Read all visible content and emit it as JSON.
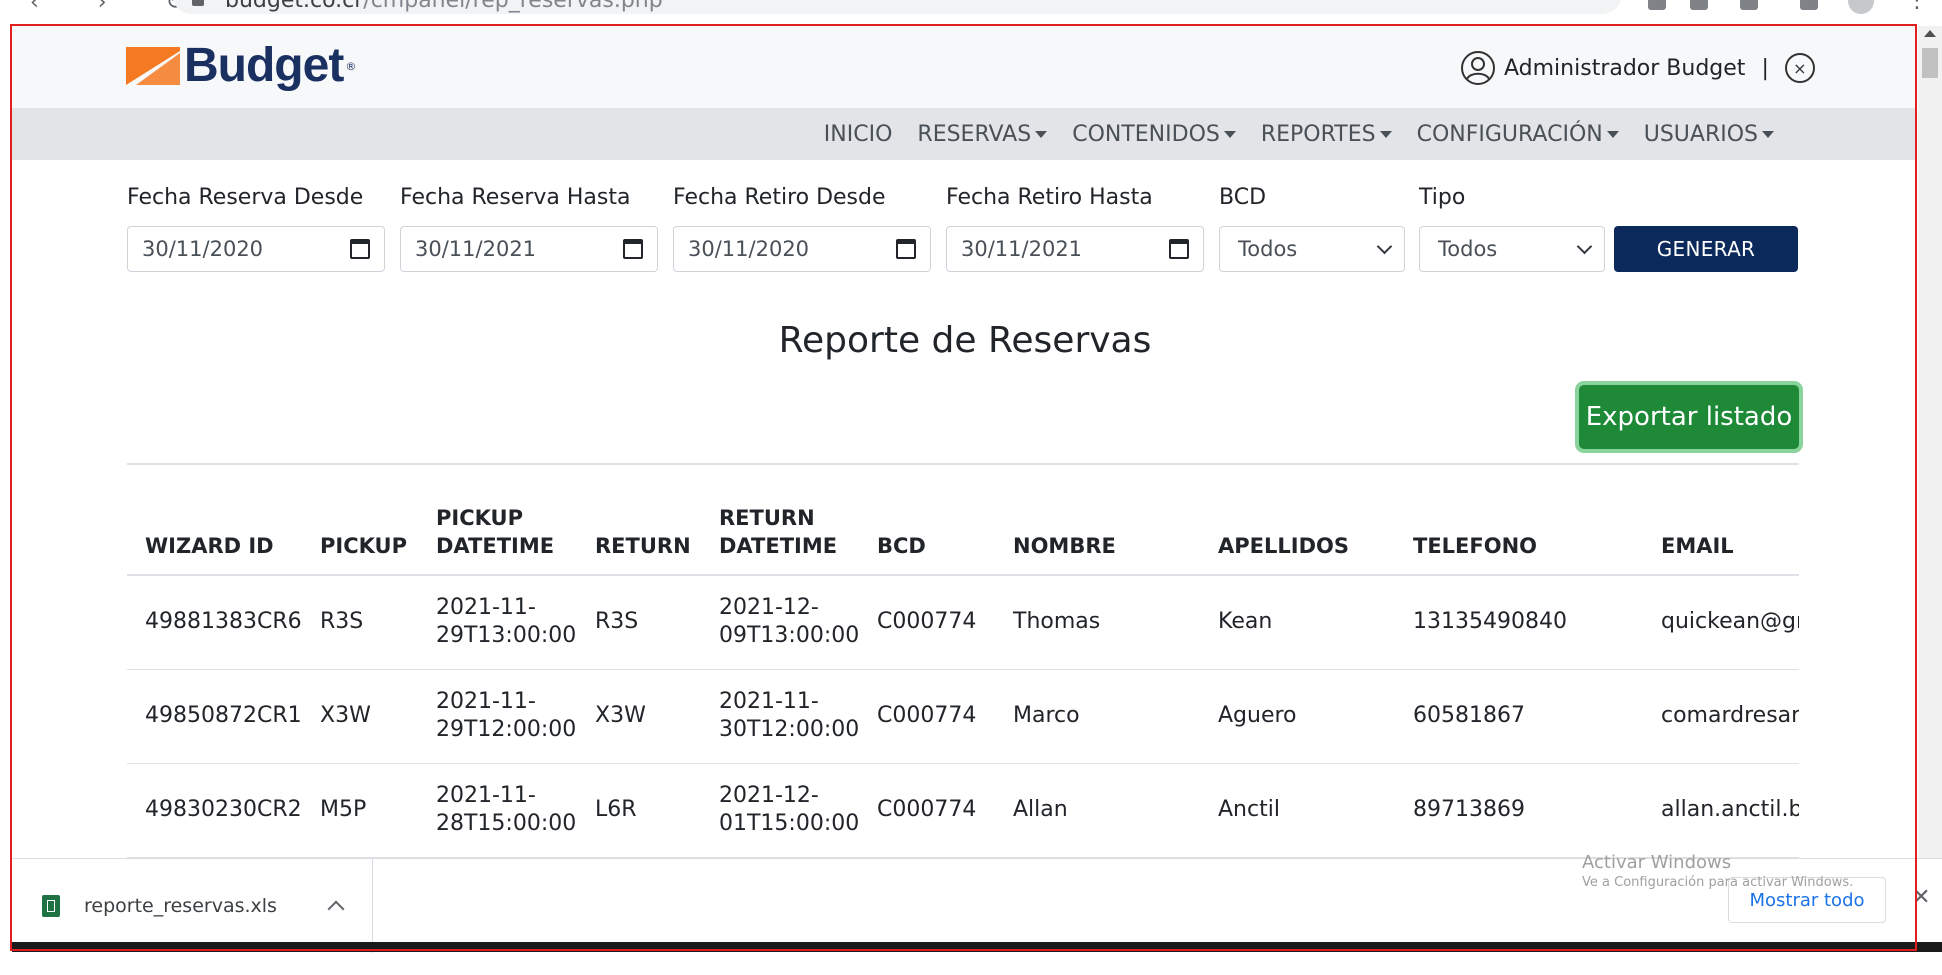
{
  "browser": {
    "url_host": "budget.co.cr",
    "url_path": "/cmpanel/rep_reservas.php"
  },
  "header": {
    "logo_text": "Budget",
    "logo_reg": "®",
    "admin_name": "Administrador Budget",
    "separator": "|",
    "close_symbol": "×"
  },
  "nav": {
    "items": [
      {
        "label": "INICIO",
        "dropdown": false
      },
      {
        "label": "RESERVAS",
        "dropdown": true
      },
      {
        "label": "CONTENIDOS",
        "dropdown": true
      },
      {
        "label": "REPORTES",
        "dropdown": true
      },
      {
        "label": "CONFIGURACIÓN",
        "dropdown": true
      },
      {
        "label": "USUARIOS",
        "dropdown": true
      }
    ]
  },
  "filters": {
    "fecha_reserva_desde": {
      "label": "Fecha Reserva Desde",
      "value": "30/11/2020"
    },
    "fecha_reserva_hasta": {
      "label": "Fecha Reserva Hasta",
      "value": "30/11/2021"
    },
    "fecha_retiro_desde": {
      "label": "Fecha Retiro Desde",
      "value": "30/11/2020"
    },
    "fecha_retiro_hasta": {
      "label": "Fecha Retiro Hasta",
      "value": "30/11/2021"
    },
    "bcd": {
      "label": "BCD",
      "value": "Todos"
    },
    "tipo": {
      "label": "Tipo",
      "value": "Todos"
    },
    "generate_label": "GENERAR"
  },
  "report": {
    "title": "Reporte de Reservas",
    "export_label": "Exportar listado"
  },
  "table": {
    "columns": [
      "WIZARD ID",
      "PICKUP",
      "PICKUP DATETIME",
      "RETURN",
      "RETURN DATETIME",
      "BCD",
      "NOMBRE",
      "APELLIDOS",
      "TELEFONO",
      "EMAIL"
    ],
    "rows": [
      [
        "49881383CR6",
        "R3S",
        "2021-11-29T13:00:00",
        "R3S",
        "2021-12-09T13:00:00",
        "C000774",
        "Thomas",
        "Kean",
        "13135490840",
        "quickean@gm"
      ],
      [
        "49850872CR1",
        "X3W",
        "2021-11-29T12:00:00",
        "X3W",
        "2021-11-30T12:00:00",
        "C000774",
        "Marco",
        "Aguero",
        "60581867",
        "comardresan("
      ],
      [
        "49830230CR2",
        "M5P",
        "2021-11-28T15:00:00",
        "L6R",
        "2021-12-01T15:00:00",
        "C000774",
        "Allan",
        "Anctil",
        "89713869",
        "allan.anctil.biz"
      ]
    ]
  },
  "downloads": {
    "file_name": "reporte_reservas.xls",
    "show_all_label": "Mostrar todo",
    "close_symbol": "✕"
  },
  "watermark": {
    "line1": "Activar Windows",
    "line2": "Ve a Configuración para activar Windows."
  },
  "colors": {
    "brand_navy": "#1a3060",
    "brand_orange": "#f47920",
    "generate_button": "#0b2a5b",
    "export_button": "#1e8a38",
    "annotation_border": "#e02020"
  }
}
